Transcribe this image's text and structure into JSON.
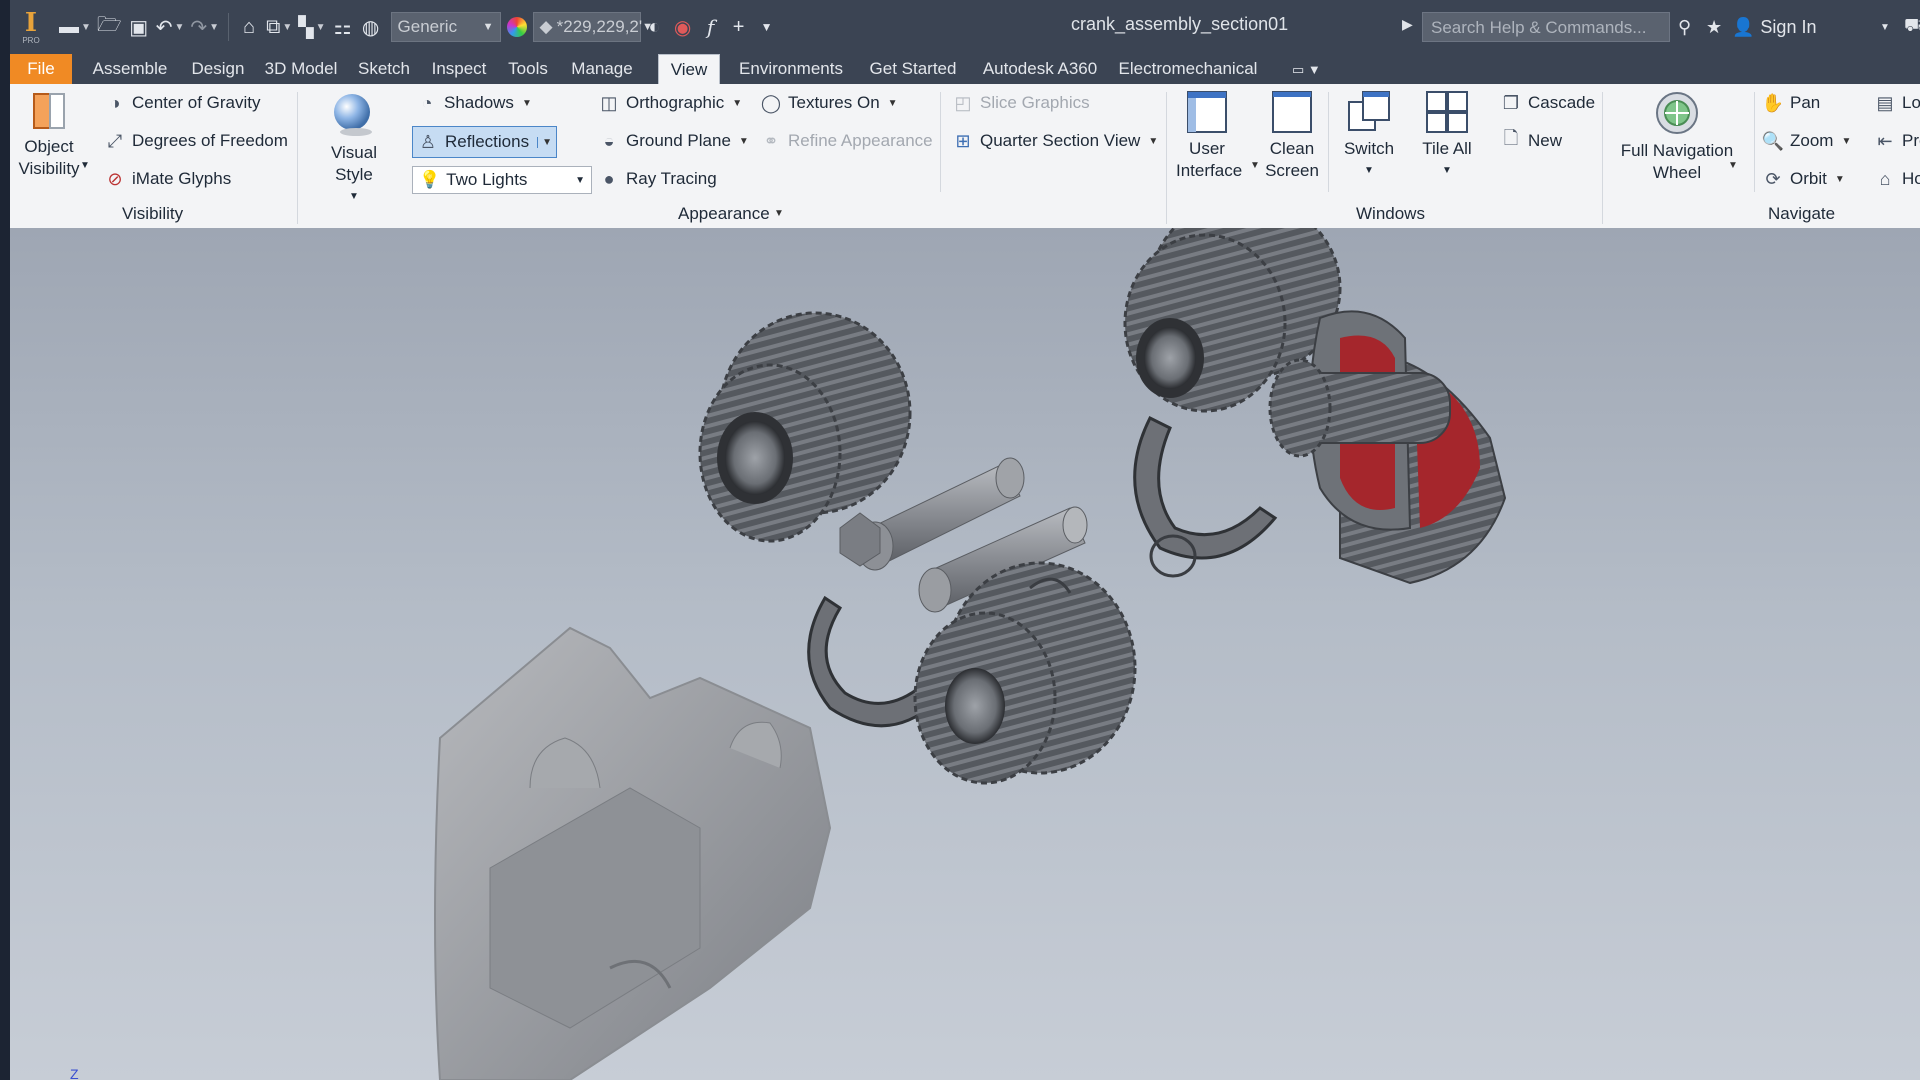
{
  "titlebar": {
    "style_combo": "Generic",
    "color_combo": "*229,229,2'",
    "document_title": "crank_assembly_section01",
    "search_placeholder": "Search Help & Commands...",
    "sign_in": "Sign In",
    "app_badge": "PRO"
  },
  "tabs": [
    {
      "label": "File"
    },
    {
      "label": "Assemble"
    },
    {
      "label": "Design"
    },
    {
      "label": "3D Model"
    },
    {
      "label": "Sketch"
    },
    {
      "label": "Inspect"
    },
    {
      "label": "Tools"
    },
    {
      "label": "Manage"
    },
    {
      "label": "View"
    },
    {
      "label": "Environments"
    },
    {
      "label": "Get Started"
    },
    {
      "label": "Autodesk A360"
    },
    {
      "label": "Electromechanical"
    }
  ],
  "ribbon": {
    "visibility": {
      "object_visibility_1": "Object",
      "object_visibility_2": "Visibility",
      "center_of_gravity": "Center of Gravity",
      "degrees_of_freedom": "Degrees of Freedom",
      "imate_glyphs": "iMate Glyphs",
      "group": "Visibility"
    },
    "appearance": {
      "visual_style": "Visual Style",
      "shadows": "Shadows",
      "reflections": "Reflections",
      "two_lights": "Two Lights",
      "orthographic": "Orthographic",
      "ground_plane": "Ground Plane",
      "ray_tracing": "Ray Tracing",
      "textures_on": "Textures On",
      "refine_appearance": "Refine Appearance",
      "group": "Appearance"
    },
    "slice": {
      "slice_graphics": "Slice Graphics",
      "quarter_section_view": "Quarter Section View"
    },
    "windows": {
      "user_interface_1": "User",
      "user_interface_2": "Interface",
      "clean_screen_1": "Clean",
      "clean_screen_2": "Screen",
      "switch": "Switch",
      "tile_all": "Tile All",
      "cascade": "Cascade",
      "new": "New",
      "group": "Windows"
    },
    "navigate": {
      "full_nav_1": "Full Navigation",
      "full_nav_2": "Wheel",
      "pan": "Pan",
      "zoom": "Zoom",
      "orbit": "Orbit",
      "look": "Loo",
      "previous": "Pre",
      "home": "Ho",
      "group": "Navigate"
    }
  },
  "viewport": {
    "axis_label": "Z"
  },
  "colors": {
    "titlebar_bg": "#3b4453",
    "file_tab": "#f08a24",
    "ribbon_bg": "#f3f4f6",
    "part_gray": "#6b6f76",
    "section_red": "#a5262c"
  }
}
